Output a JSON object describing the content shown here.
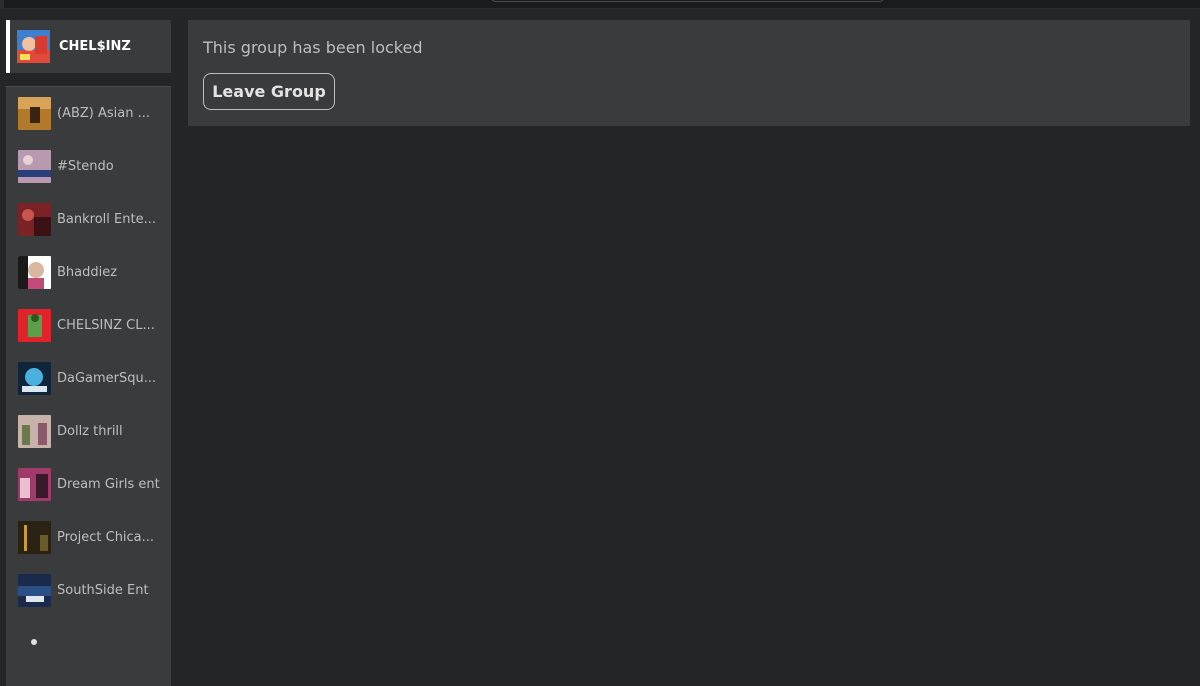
{
  "selected_group": {
    "name": "CHEL$INZ"
  },
  "main": {
    "message": "This group has been locked",
    "leave_button": "Leave Group"
  },
  "groups": [
    {
      "label": "(ABZ) Asian ...",
      "thumb": "#b07a2a"
    },
    {
      "label": "#Stendo",
      "thumb": "#b899b0"
    },
    {
      "label": "Bankroll Ente...",
      "thumb": "#7a2226"
    },
    {
      "label": "Bhaddiez",
      "thumb": "#d8b8a0"
    },
    {
      "label": "CHELSINZ CL...",
      "thumb": "#e0232a"
    },
    {
      "label": "DaGamerSqu...",
      "thumb": "#1d5a8a"
    },
    {
      "label": "Dollz thrill",
      "thumb": "#c7b3aa"
    },
    {
      "label": "Dream Girls ent",
      "thumb": "#a03a6a"
    },
    {
      "label": "Project Chica...",
      "thumb": "#4a3a18"
    },
    {
      "label": "SouthSide Ent",
      "thumb": "#2a4f86"
    }
  ],
  "colors": {
    "background": "#232527",
    "panel": "#393b3d",
    "selected_indicator": "#ffffff",
    "muted_text": "#bdbebe"
  }
}
